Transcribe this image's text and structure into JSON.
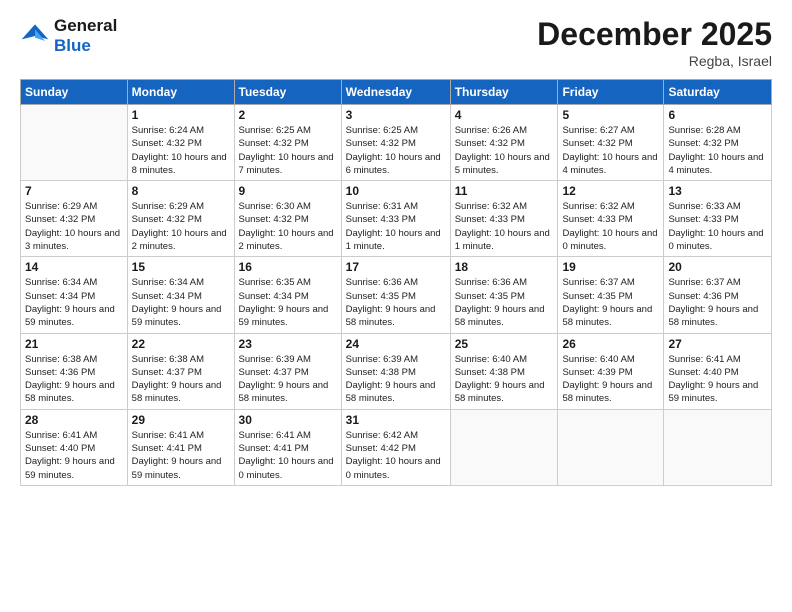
{
  "header": {
    "logo_line1": "General",
    "logo_line2": "Blue",
    "month": "December 2025",
    "location": "Regba, Israel"
  },
  "days_of_week": [
    "Sunday",
    "Monday",
    "Tuesday",
    "Wednesday",
    "Thursday",
    "Friday",
    "Saturday"
  ],
  "weeks": [
    [
      {
        "day": "",
        "sunrise": "",
        "sunset": "",
        "daylight": ""
      },
      {
        "day": "1",
        "sunrise": "Sunrise: 6:24 AM",
        "sunset": "Sunset: 4:32 PM",
        "daylight": "Daylight: 10 hours and 8 minutes."
      },
      {
        "day": "2",
        "sunrise": "Sunrise: 6:25 AM",
        "sunset": "Sunset: 4:32 PM",
        "daylight": "Daylight: 10 hours and 7 minutes."
      },
      {
        "day": "3",
        "sunrise": "Sunrise: 6:25 AM",
        "sunset": "Sunset: 4:32 PM",
        "daylight": "Daylight: 10 hours and 6 minutes."
      },
      {
        "day": "4",
        "sunrise": "Sunrise: 6:26 AM",
        "sunset": "Sunset: 4:32 PM",
        "daylight": "Daylight: 10 hours and 5 minutes."
      },
      {
        "day": "5",
        "sunrise": "Sunrise: 6:27 AM",
        "sunset": "Sunset: 4:32 PM",
        "daylight": "Daylight: 10 hours and 4 minutes."
      },
      {
        "day": "6",
        "sunrise": "Sunrise: 6:28 AM",
        "sunset": "Sunset: 4:32 PM",
        "daylight": "Daylight: 10 hours and 4 minutes."
      }
    ],
    [
      {
        "day": "7",
        "sunrise": "Sunrise: 6:29 AM",
        "sunset": "Sunset: 4:32 PM",
        "daylight": "Daylight: 10 hours and 3 minutes."
      },
      {
        "day": "8",
        "sunrise": "Sunrise: 6:29 AM",
        "sunset": "Sunset: 4:32 PM",
        "daylight": "Daylight: 10 hours and 2 minutes."
      },
      {
        "day": "9",
        "sunrise": "Sunrise: 6:30 AM",
        "sunset": "Sunset: 4:32 PM",
        "daylight": "Daylight: 10 hours and 2 minutes."
      },
      {
        "day": "10",
        "sunrise": "Sunrise: 6:31 AM",
        "sunset": "Sunset: 4:33 PM",
        "daylight": "Daylight: 10 hours and 1 minute."
      },
      {
        "day": "11",
        "sunrise": "Sunrise: 6:32 AM",
        "sunset": "Sunset: 4:33 PM",
        "daylight": "Daylight: 10 hours and 1 minute."
      },
      {
        "day": "12",
        "sunrise": "Sunrise: 6:32 AM",
        "sunset": "Sunset: 4:33 PM",
        "daylight": "Daylight: 10 hours and 0 minutes."
      },
      {
        "day": "13",
        "sunrise": "Sunrise: 6:33 AM",
        "sunset": "Sunset: 4:33 PM",
        "daylight": "Daylight: 10 hours and 0 minutes."
      }
    ],
    [
      {
        "day": "14",
        "sunrise": "Sunrise: 6:34 AM",
        "sunset": "Sunset: 4:34 PM",
        "daylight": "Daylight: 9 hours and 59 minutes."
      },
      {
        "day": "15",
        "sunrise": "Sunrise: 6:34 AM",
        "sunset": "Sunset: 4:34 PM",
        "daylight": "Daylight: 9 hours and 59 minutes."
      },
      {
        "day": "16",
        "sunrise": "Sunrise: 6:35 AM",
        "sunset": "Sunset: 4:34 PM",
        "daylight": "Daylight: 9 hours and 59 minutes."
      },
      {
        "day": "17",
        "sunrise": "Sunrise: 6:36 AM",
        "sunset": "Sunset: 4:35 PM",
        "daylight": "Daylight: 9 hours and 58 minutes."
      },
      {
        "day": "18",
        "sunrise": "Sunrise: 6:36 AM",
        "sunset": "Sunset: 4:35 PM",
        "daylight": "Daylight: 9 hours and 58 minutes."
      },
      {
        "day": "19",
        "sunrise": "Sunrise: 6:37 AM",
        "sunset": "Sunset: 4:35 PM",
        "daylight": "Daylight: 9 hours and 58 minutes."
      },
      {
        "day": "20",
        "sunrise": "Sunrise: 6:37 AM",
        "sunset": "Sunset: 4:36 PM",
        "daylight": "Daylight: 9 hours and 58 minutes."
      }
    ],
    [
      {
        "day": "21",
        "sunrise": "Sunrise: 6:38 AM",
        "sunset": "Sunset: 4:36 PM",
        "daylight": "Daylight: 9 hours and 58 minutes."
      },
      {
        "day": "22",
        "sunrise": "Sunrise: 6:38 AM",
        "sunset": "Sunset: 4:37 PM",
        "daylight": "Daylight: 9 hours and 58 minutes."
      },
      {
        "day": "23",
        "sunrise": "Sunrise: 6:39 AM",
        "sunset": "Sunset: 4:37 PM",
        "daylight": "Daylight: 9 hours and 58 minutes."
      },
      {
        "day": "24",
        "sunrise": "Sunrise: 6:39 AM",
        "sunset": "Sunset: 4:38 PM",
        "daylight": "Daylight: 9 hours and 58 minutes."
      },
      {
        "day": "25",
        "sunrise": "Sunrise: 6:40 AM",
        "sunset": "Sunset: 4:38 PM",
        "daylight": "Daylight: 9 hours and 58 minutes."
      },
      {
        "day": "26",
        "sunrise": "Sunrise: 6:40 AM",
        "sunset": "Sunset: 4:39 PM",
        "daylight": "Daylight: 9 hours and 58 minutes."
      },
      {
        "day": "27",
        "sunrise": "Sunrise: 6:41 AM",
        "sunset": "Sunset: 4:40 PM",
        "daylight": "Daylight: 9 hours and 59 minutes."
      }
    ],
    [
      {
        "day": "28",
        "sunrise": "Sunrise: 6:41 AM",
        "sunset": "Sunset: 4:40 PM",
        "daylight": "Daylight: 9 hours and 59 minutes."
      },
      {
        "day": "29",
        "sunrise": "Sunrise: 6:41 AM",
        "sunset": "Sunset: 4:41 PM",
        "daylight": "Daylight: 9 hours and 59 minutes."
      },
      {
        "day": "30",
        "sunrise": "Sunrise: 6:41 AM",
        "sunset": "Sunset: 4:41 PM",
        "daylight": "Daylight: 10 hours and 0 minutes."
      },
      {
        "day": "31",
        "sunrise": "Sunrise: 6:42 AM",
        "sunset": "Sunset: 4:42 PM",
        "daylight": "Daylight: 10 hours and 0 minutes."
      },
      {
        "day": "",
        "sunrise": "",
        "sunset": "",
        "daylight": ""
      },
      {
        "day": "",
        "sunrise": "",
        "sunset": "",
        "daylight": ""
      },
      {
        "day": "",
        "sunrise": "",
        "sunset": "",
        "daylight": ""
      }
    ]
  ]
}
